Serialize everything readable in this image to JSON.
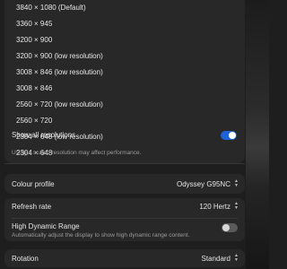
{
  "resolutions": [
    "3840 × 1080 (Default)",
    "3360 × 945",
    "3200 × 900",
    "3200 × 900 (low resolution)",
    "3008 × 846 (low resolution)",
    "3008 × 846",
    "2560 × 720 (low resolution)",
    "2560 × 720",
    "2304 × 648 (low resolution)",
    "2304 × 648"
  ],
  "show_all": {
    "label": "Show all resolutions",
    "enabled": true
  },
  "scaled_note": "Using a scaled resolution may affect performance.",
  "colour_profile": {
    "label": "Colour profile",
    "value": "Odyssey G95NC"
  },
  "refresh_rate": {
    "label": "Refresh rate",
    "value": "120 Hertz"
  },
  "hdr": {
    "label": "High Dynamic Range",
    "description": "Automatically adjust the display to show high dynamic range content.",
    "enabled": false
  },
  "rotation": {
    "label": "Rotation",
    "value": "Standard"
  },
  "colors": {
    "accent": "#1d63d6",
    "panel": "#282828",
    "background": "#1e1e1e"
  }
}
